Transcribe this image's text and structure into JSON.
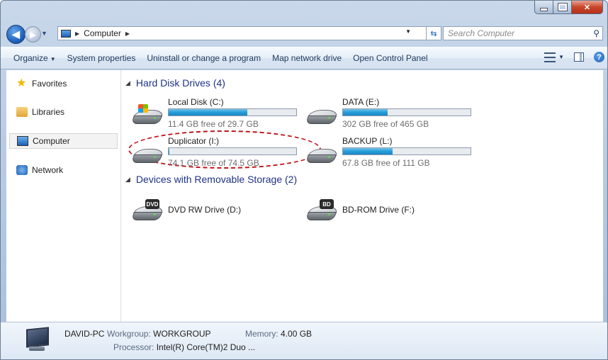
{
  "address": {
    "crumb": "Computer",
    "search_placeholder": "Search Computer"
  },
  "toolbar": {
    "organize": "Organize",
    "system_properties": "System properties",
    "uninstall": "Uninstall or change a program",
    "map_drive": "Map network drive",
    "control_panel": "Open Control Panel"
  },
  "sidebar": {
    "items": [
      {
        "label": "Favorites",
        "icon": "star-icon"
      },
      {
        "label": "Libraries",
        "icon": "libraries-icon"
      },
      {
        "label": "Computer",
        "icon": "computer-icon",
        "selected": true
      },
      {
        "label": "Network",
        "icon": "network-icon"
      }
    ]
  },
  "groups": {
    "hdd": "Hard Disk Drives (4)",
    "removable": "Devices with Removable Storage (2)"
  },
  "drives": [
    {
      "name": "Local Disk (C:)",
      "free": "11.4 GB free of 29.7 GB",
      "used_fraction": 0.616
    },
    {
      "name": "DATA (E:)",
      "free": "302 GB free of 465 GB",
      "used_fraction": 0.35
    },
    {
      "name": "Duplicator (I:)",
      "free": "74.1 GB free of 74.5 GB",
      "used_fraction": 0.005
    },
    {
      "name": "BACKUP (L:)",
      "free": "67.8 GB free of 111 GB",
      "used_fraction": 0.39
    }
  ],
  "removable": [
    {
      "name": "DVD RW Drive (D:)",
      "badge": "DVD"
    },
    {
      "name": "BD-ROM Drive (F:)",
      "badge": "BD"
    }
  ],
  "details": {
    "pc_name": "DAVID-PC",
    "workgroup_key": "Workgroup:",
    "workgroup": "WORKGROUP",
    "memory_key": "Memory:",
    "memory": "4.00 GB",
    "processor_key": "Processor:",
    "processor": "Intel(R) Core(TM)2 Duo ..."
  },
  "colors": {
    "bar_fill": "#26a0da",
    "highlight_ellipse": "#c0141a",
    "group_header": "#1e3287"
  }
}
